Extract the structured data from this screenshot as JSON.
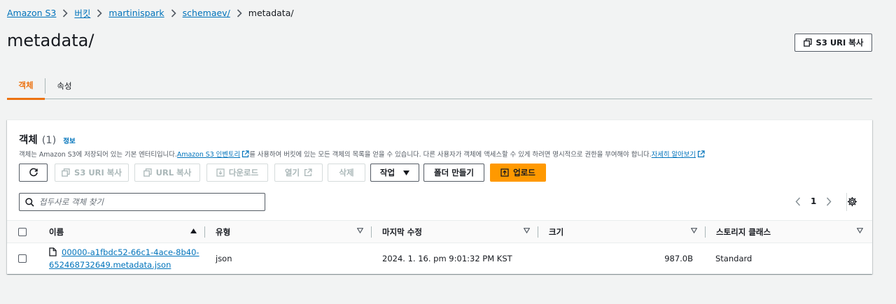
{
  "breadcrumb": {
    "items": [
      "Amazon S3",
      "버킷",
      "martinispark",
      "schemaev/"
    ],
    "current": "metadata/"
  },
  "header": {
    "title": "metadata/",
    "copy_uri_label": "S3 URI 복사"
  },
  "tabs": [
    {
      "label": "객체",
      "active": true
    },
    {
      "label": "속성",
      "active": false
    }
  ],
  "objects_panel": {
    "title": "객체",
    "count": "(1)",
    "info_label": "정보",
    "desc_part1": "객체는 Amazon S3에 저장되어 있는 기본 엔터티입니다. ",
    "desc_link1": "Amazon S3 인벤토리",
    "desc_part2": "를 사용하여 버킷에 있는 모든 객체의 목록을 얻을 수 있습니다. 다른 사용자가 객체에 액세스할 수 있게 하려면 명시적으로 권한을 부여해야 합니다. ",
    "desc_link2": "자세히 알아보기"
  },
  "toolbar": {
    "copy_s3_uri": "S3 URI 복사",
    "copy_url": "URL 복사",
    "download": "다운로드",
    "open": "열기",
    "delete": "삭제",
    "actions": "작업",
    "create_folder": "폴더 만들기",
    "upload": "업로드"
  },
  "search": {
    "placeholder": "접두사로 객체 찾기"
  },
  "pagination": {
    "current_page": "1"
  },
  "table": {
    "columns": [
      "이름",
      "유형",
      "마지막 수정",
      "크기",
      "스토리지 클래스"
    ],
    "rows": [
      {
        "name_line1": "00000-a1fbdc52-66c1-4ace-8b40-",
        "name_line2": "652468732649.metadata.json",
        "type": "json",
        "last_modified": "2024. 1. 16. pm 9:01:32 PM KST",
        "size": "987.0B",
        "storage_class": "Standard"
      }
    ]
  },
  "colors": {
    "link": "#0073bb",
    "accent_orange": "#ec7211",
    "primary_button": "#ff9900",
    "background": "#f2f3f3"
  }
}
